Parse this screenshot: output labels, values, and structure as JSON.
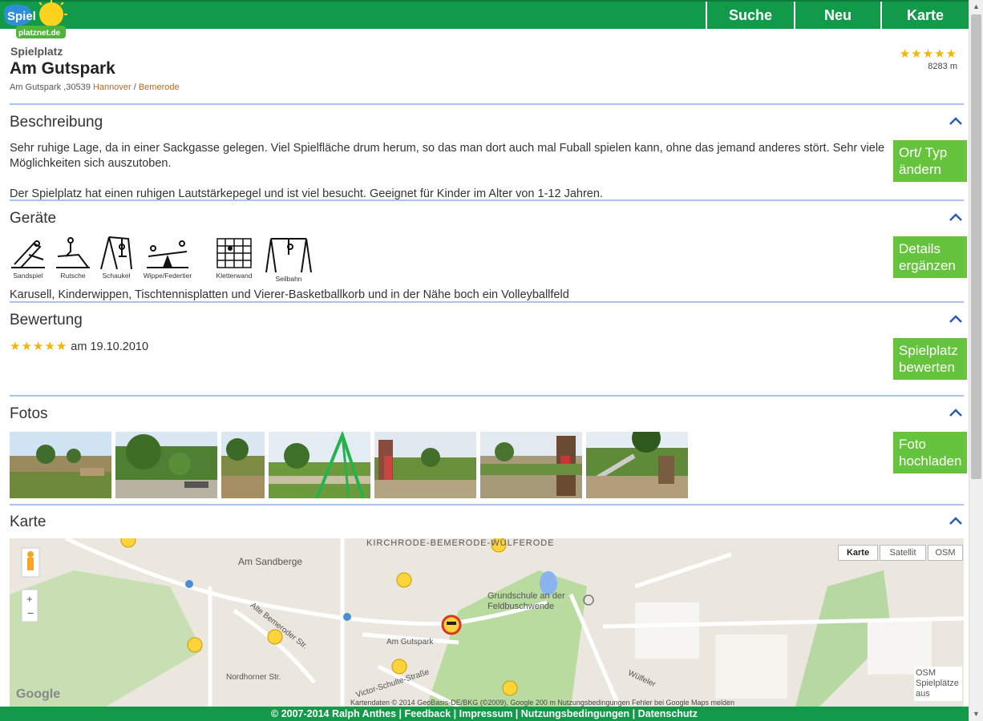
{
  "nav": {
    "search": "Suche",
    "new": "Neu",
    "map": "Karte"
  },
  "logo": {
    "text": "Spielplatznet.de"
  },
  "header": {
    "category": "Spielplatz",
    "title": "Am Gutspark",
    "address": "Am Gutspark ,30539",
    "city": "Hannover",
    "separator": "/",
    "district": "Bemerode",
    "rating_stars": "★★★★★",
    "distance": "8283 m"
  },
  "sections": {
    "description": {
      "heading": "Beschreibung",
      "text1": "Sehr ruhige Lage, da in einer Sackgasse gelegen. Viel Spielfläche drum herum, so das man dort auch mal Fuball spielen kann, ohne das jemand anderes stört. Sehr viele Möglichkeiten sich auszutoben.",
      "text2": "Der Spielplatz hat einen ruhigen Lautstärkepegel und ist viel besucht. Geeignet für Kinder im Alter von 1-12 Jahren.",
      "button": "Ort/ Typ ändern"
    },
    "equipment": {
      "heading": "Geräte",
      "items": [
        "Sandspiel",
        "Rutsche",
        "Schaukel",
        "Wippe/Federtier",
        "Kletterwand",
        "Seilbahn"
      ],
      "text": "Karusell, Kinderwippen, Tischtennisplatten und Vierer-Basketballkorb und in der Nähe boch ein Volleyballfeld",
      "button": "Details ergänzen"
    },
    "rating": {
      "heading": "Bewertung",
      "stars": "★★★★★",
      "date_text": "am 19.10.2010",
      "button": "Spielplatz bewerten"
    },
    "photos": {
      "heading": "Fotos",
      "count": 7,
      "button": "Foto hochladen"
    },
    "map": {
      "heading": "Karte",
      "tabs": [
        "Karte",
        "Satellit",
        "OSM"
      ],
      "labels": {
        "district": "KIRCHRODE-BEMERODE-WÜLFERODE",
        "street1": "Am Sandberge",
        "school": "Grundschule an der Feldbuschwende",
        "gutspark": "Am Gutspark",
        "street2": "Alte Bemeroder Str.",
        "street3": "Nordhorner Str.",
        "street4": "Victor-Schulte-Straße",
        "street5": "Wülfeler",
        "osm_note": "OSM Spielplätze aus",
        "google": "Google",
        "copyright": "Kartendaten © 2014 GeoBasis-DE/BKG (©2009), Google    200 m    Nutzungsbedingungen    Fehler bei Google Maps melden"
      }
    }
  },
  "footer": {
    "copyright": "© 2007-2014 Ralph Anthes",
    "links": [
      "Feedback",
      "Impressum",
      "Nutzungsbedingungen",
      "Datenschutz"
    ]
  },
  "colors": {
    "green": "#119a49",
    "button_green": "#66c33e",
    "star": "#f5b400",
    "divider": "#a9c4e8"
  }
}
